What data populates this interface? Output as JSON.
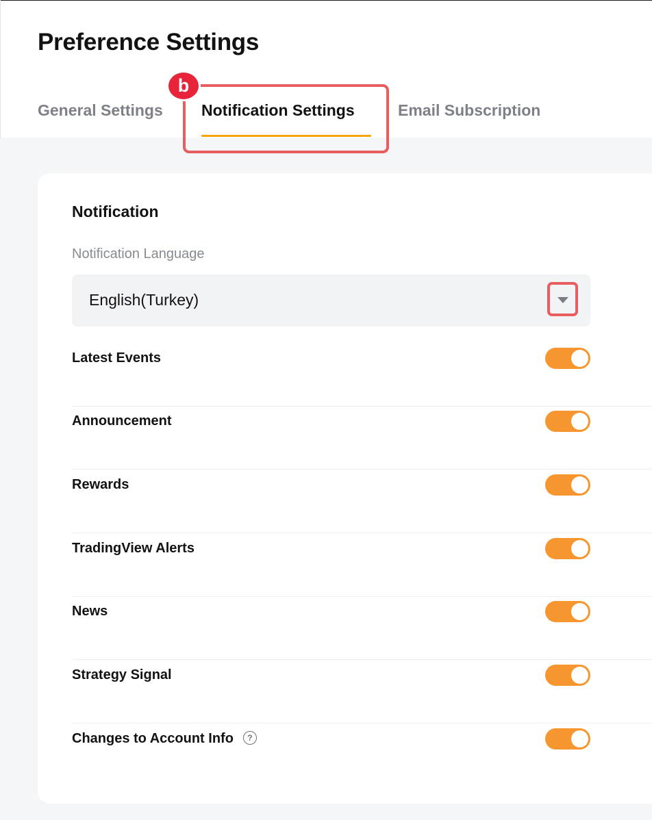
{
  "page": {
    "title": "Preference Settings"
  },
  "tabs": [
    {
      "label": "General Settings",
      "active": false
    },
    {
      "label": "Notification Settings",
      "active": true
    },
    {
      "label": "Email Subscription",
      "active": false
    }
  ],
  "annotation": {
    "badge": "b"
  },
  "notification": {
    "section_title": "Notification",
    "language_label": "Notification Language",
    "language_value": "English(Turkey)",
    "items": [
      {
        "label": "Latest Events",
        "enabled": true
      },
      {
        "label": "Announcement",
        "enabled": true
      },
      {
        "label": "Rewards",
        "enabled": true
      },
      {
        "label": "TradingView Alerts",
        "enabled": true
      },
      {
        "label": "News",
        "enabled": true
      },
      {
        "label": "Strategy Signal",
        "enabled": true
      },
      {
        "label": "Changes to Account Info",
        "enabled": true,
        "help_icon": "question-circle-icon"
      }
    ]
  },
  "colors": {
    "accent": "#f7a600",
    "toggle_on": "#f7962f",
    "annotation": "#e85d60",
    "badge": "#e8243a"
  }
}
